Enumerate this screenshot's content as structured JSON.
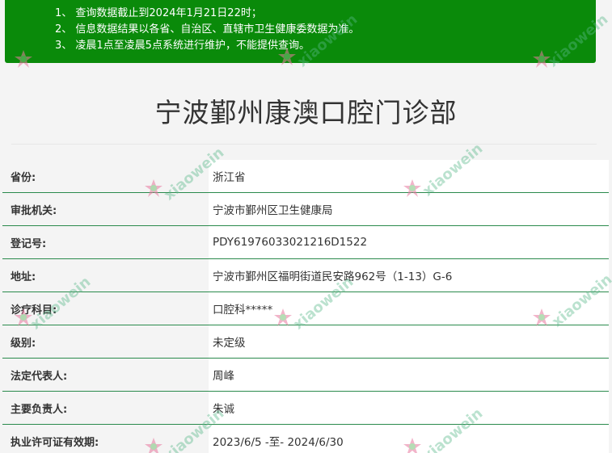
{
  "notice": {
    "lines": [
      "1、 查询数据截止到2024年1月21日22时；",
      "2、 信息数据结果以各省、自治区、直辖市卫生健康委数据为准。",
      "3、 凌晨1点至凌晨5点系统进行维护，不能提供查询。"
    ]
  },
  "clinic": {
    "title": "宁波鄞州康澳口腔门诊部"
  },
  "info": {
    "rows": [
      {
        "label": "省份:",
        "value": "浙江省"
      },
      {
        "label": "审批机关:",
        "value": "宁波市鄞州区卫生健康局"
      },
      {
        "label": "登记号:",
        "value": "PDY61976033021216D1522"
      },
      {
        "label": "地址:",
        "value": "宁波市鄞州区福明街道民安路962号（1-13）G-6"
      },
      {
        "label": "诊疗科目:",
        "value": "口腔科*****"
      },
      {
        "label": "级别:",
        "value": "未定级"
      },
      {
        "label": "法定代表人:",
        "value": "周峰"
      },
      {
        "label": "主要负责人:",
        "value": "朱诚"
      },
      {
        "label": "执业许可证有效期:",
        "value": "2023/6/5 -至- 2024/6/30"
      }
    ]
  },
  "watermark": {
    "text": "xiaowein",
    "icon": "tooth-flower-logo-icon",
    "color": "#5ab88a"
  },
  "colors": {
    "notice_bg": "#0a8a0a",
    "row_border": "#2a8a4c",
    "page_bg": "#f4f4f4"
  }
}
